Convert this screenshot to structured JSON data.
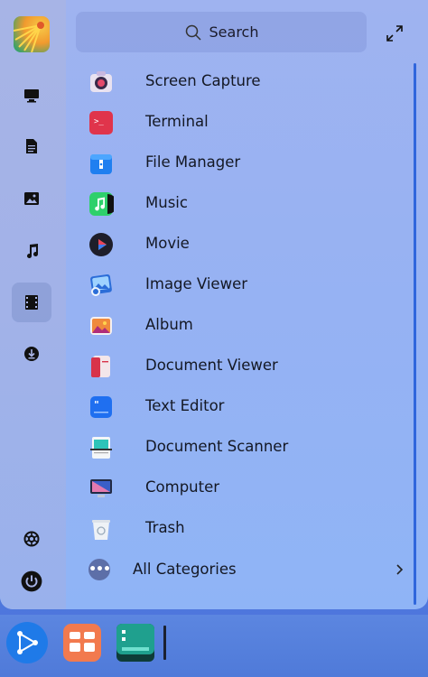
{
  "search": {
    "placeholder": "Search"
  },
  "apps": [
    {
      "label": "Screen Capture",
      "icon": "screen-capture-icon"
    },
    {
      "label": "Terminal",
      "icon": "terminal-icon"
    },
    {
      "label": "File Manager",
      "icon": "file-manager-icon"
    },
    {
      "label": "Music",
      "icon": "music-icon"
    },
    {
      "label": "Movie",
      "icon": "movie-icon"
    },
    {
      "label": "Image Viewer",
      "icon": "image-viewer-icon"
    },
    {
      "label": "Album",
      "icon": "album-icon"
    },
    {
      "label": "Document Viewer",
      "icon": "document-viewer-icon"
    },
    {
      "label": "Text Editor",
      "icon": "text-editor-icon"
    },
    {
      "label": "Document Scanner",
      "icon": "document-scanner-icon"
    },
    {
      "label": "Computer",
      "icon": "computer-icon"
    },
    {
      "label": "Trash",
      "icon": "trash-icon"
    }
  ],
  "all_categories": {
    "label": "All Categories"
  },
  "sidebar": {
    "items": [
      {
        "icon": "desktop-icon"
      },
      {
        "icon": "document-icon"
      },
      {
        "icon": "picture-icon"
      },
      {
        "icon": "music-note-icon"
      },
      {
        "icon": "video-icon",
        "active": true
      },
      {
        "icon": "download-icon"
      }
    ],
    "bottom": [
      {
        "icon": "settings-icon"
      },
      {
        "icon": "power-icon"
      }
    ]
  },
  "colors": {
    "accent": "#2f66dc"
  }
}
